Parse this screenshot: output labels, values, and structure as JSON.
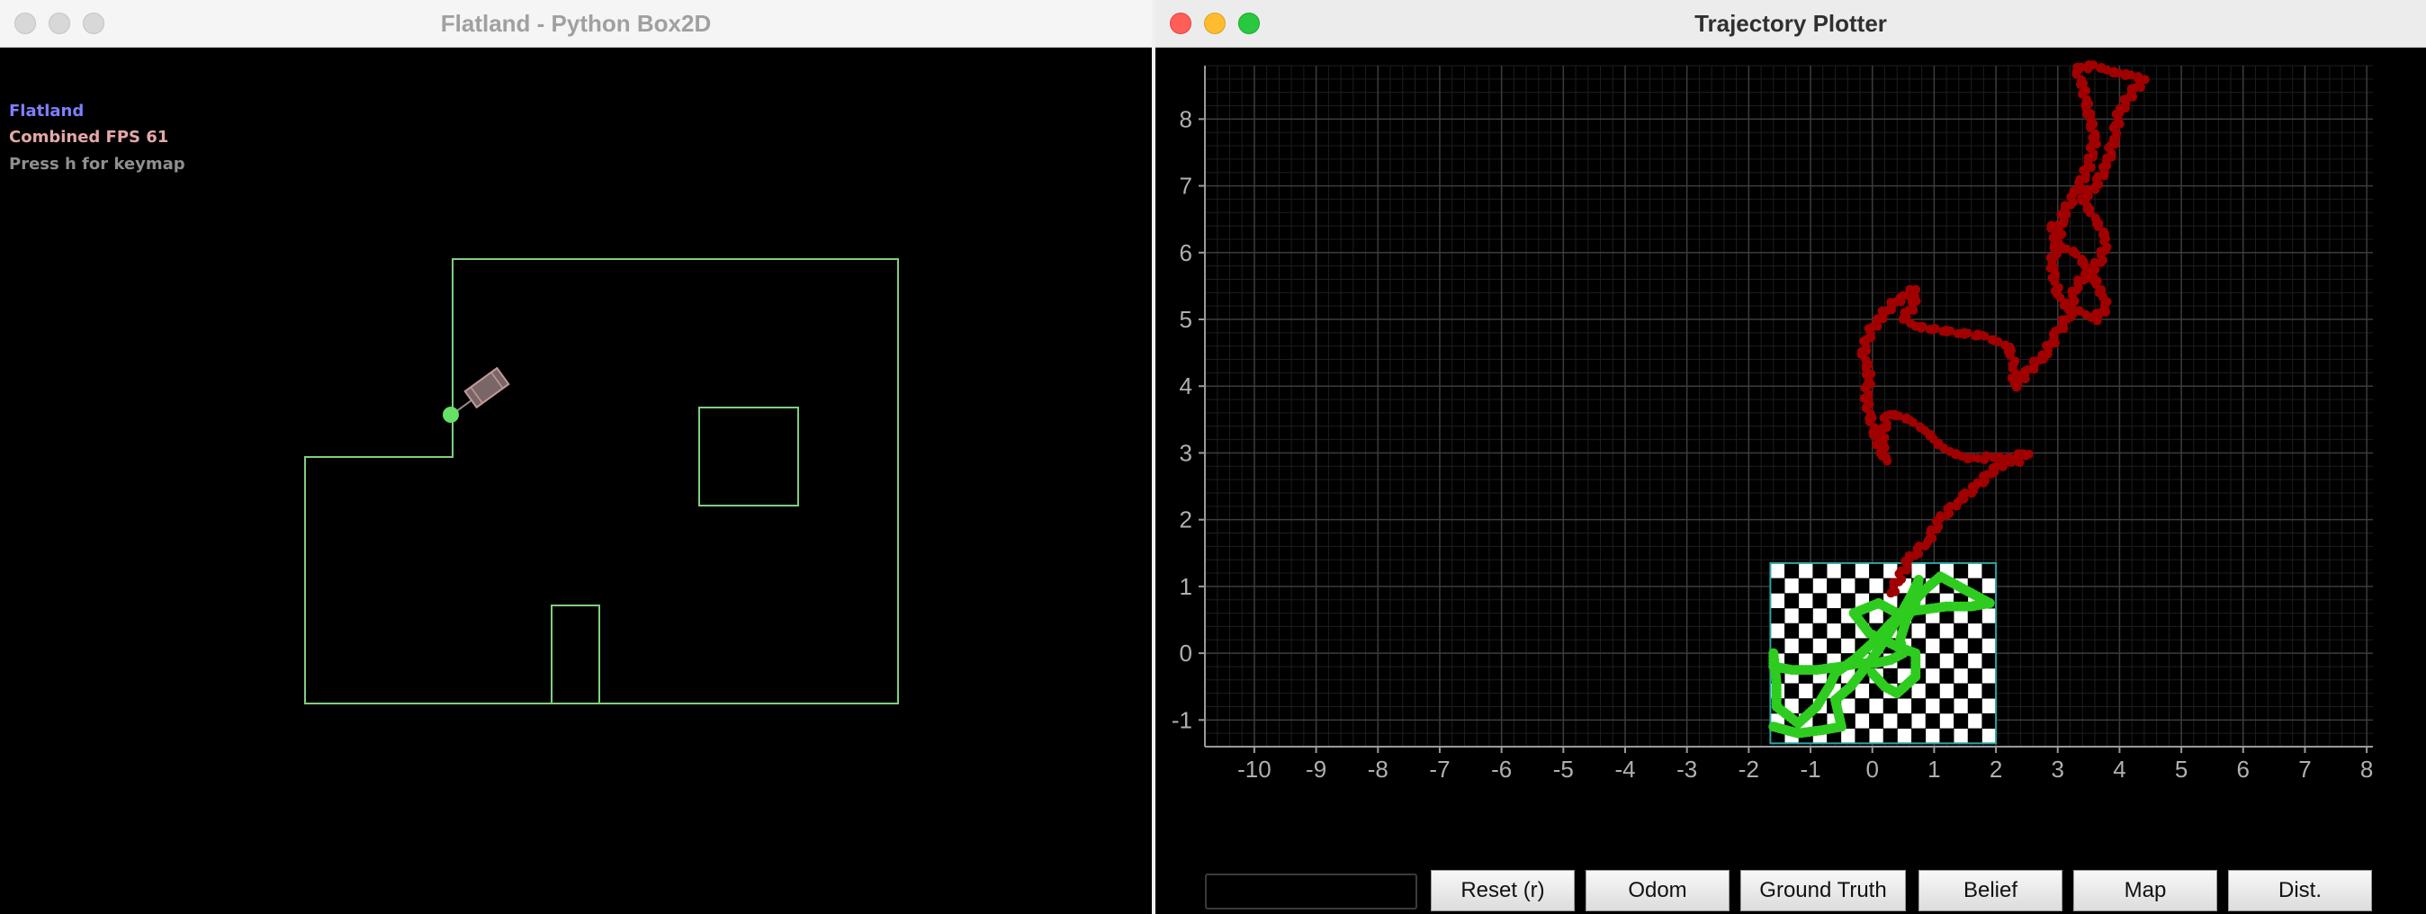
{
  "left_window": {
    "title": "Flatland - Python Box2D",
    "hud": [
      "Flatland",
      "Combined FPS 61",
      "Press h for keymap"
    ],
    "colors": {
      "walls": "#7fcf7f",
      "robot": "#b08a8a",
      "marker": "#66e066",
      "background": "#000000"
    }
  },
  "right_window": {
    "title": "Trajectory Plotter",
    "input_value": "",
    "buttons": [
      "Reset (r)",
      "Odom",
      "Ground Truth",
      "Belief",
      "Map",
      "Dist."
    ]
  },
  "chart_data": {
    "type": "scatter",
    "title": "",
    "xlabel": "",
    "ylabel": "",
    "xlim": [
      -10.8,
      8.1
    ],
    "ylim": [
      -1.4,
      8.8
    ],
    "xticks": [
      -10,
      -9,
      -8,
      -7,
      -6,
      -5,
      -4,
      -3,
      -2,
      -1,
      0,
      1,
      2,
      3,
      4,
      5,
      6,
      7,
      8
    ],
    "yticks": [
      -1,
      0,
      1,
      2,
      3,
      4,
      5,
      6,
      7,
      8
    ],
    "grid": true,
    "legend": "none",
    "overlay": {
      "name": "checkerboard",
      "x_range": [
        -1.65,
        2.0
      ],
      "y_range": [
        -1.35,
        1.35
      ],
      "columns": 16,
      "rows": 12,
      "border_color": "#2aa4a4"
    },
    "series": [
      {
        "color": "#a00000",
        "points": [
          [
            0.3,
            0.9
          ],
          [
            0.6,
            1.4
          ],
          [
            0.9,
            1.7
          ],
          [
            1.1,
            2.0
          ],
          [
            1.4,
            2.3
          ],
          [
            1.7,
            2.5
          ],
          [
            1.9,
            2.7
          ],
          [
            2.2,
            2.9
          ],
          [
            2.5,
            3.0
          ],
          [
            2.3,
            2.85
          ],
          [
            2.0,
            2.95
          ],
          [
            1.6,
            2.9
          ],
          [
            1.3,
            3.0
          ],
          [
            1.1,
            3.1
          ],
          [
            0.9,
            3.3
          ],
          [
            0.6,
            3.5
          ],
          [
            0.25,
            3.6
          ],
          [
            0.15,
            3.2
          ],
          [
            0.2,
            2.9
          ],
          [
            0.1,
            3.1
          ],
          [
            0.0,
            3.4
          ],
          [
            -0.1,
            3.8
          ],
          [
            -0.05,
            4.2
          ],
          [
            -0.15,
            4.5
          ],
          [
            -0.05,
            4.8
          ],
          [
            0.1,
            5.0
          ],
          [
            0.3,
            5.2
          ],
          [
            0.5,
            5.35
          ],
          [
            0.7,
            5.45
          ],
          [
            0.65,
            5.2
          ],
          [
            0.5,
            5.0
          ],
          [
            0.7,
            4.9
          ],
          [
            1.0,
            4.85
          ],
          [
            1.4,
            4.8
          ],
          [
            1.8,
            4.75
          ],
          [
            2.2,
            4.6
          ],
          [
            2.3,
            4.3
          ],
          [
            2.3,
            4.0
          ],
          [
            2.5,
            4.2
          ],
          [
            2.8,
            4.5
          ],
          [
            3.0,
            4.8
          ],
          [
            3.2,
            5.1
          ],
          [
            3.0,
            5.4
          ],
          [
            2.9,
            5.8
          ],
          [
            3.0,
            6.2
          ],
          [
            3.1,
            6.6
          ],
          [
            3.3,
            6.9
          ],
          [
            3.5,
            7.3
          ],
          [
            3.6,
            7.7
          ],
          [
            3.5,
            8.1
          ],
          [
            3.4,
            8.5
          ],
          [
            3.3,
            8.75
          ],
          [
            3.6,
            8.8
          ],
          [
            3.9,
            8.7
          ],
          [
            4.2,
            8.65
          ],
          [
            4.4,
            8.6
          ],
          [
            4.2,
            8.4
          ],
          [
            4.0,
            8.1
          ],
          [
            3.9,
            7.7
          ],
          [
            3.8,
            7.3
          ],
          [
            3.6,
            7.0
          ],
          [
            3.4,
            6.8
          ],
          [
            3.6,
            6.5
          ],
          [
            3.8,
            6.2
          ],
          [
            3.7,
            5.9
          ],
          [
            3.5,
            5.7
          ],
          [
            3.3,
            5.5
          ],
          [
            3.2,
            5.2
          ],
          [
            3.6,
            5.0
          ],
          [
            3.8,
            5.2
          ],
          [
            3.6,
            5.6
          ],
          [
            3.3,
            6.0
          ],
          [
            3.0,
            6.1
          ],
          [
            2.9,
            6.4
          ]
        ]
      },
      {
        "color": "#2ecc1f",
        "points": [
          [
            -1.6,
            -1.1
          ],
          [
            -1.2,
            -1.2
          ],
          [
            -0.8,
            -1.15
          ],
          [
            -0.5,
            -1.1
          ],
          [
            -0.6,
            -0.7
          ],
          [
            -0.35,
            -0.5
          ],
          [
            -0.1,
            -0.2
          ],
          [
            0.1,
            0.05
          ],
          [
            0.3,
            0.35
          ],
          [
            0.5,
            0.65
          ],
          [
            0.65,
            0.9
          ],
          [
            0.75,
            1.1
          ],
          [
            0.7,
            0.75
          ],
          [
            0.55,
            0.5
          ],
          [
            0.45,
            0.2
          ],
          [
            0.5,
            0.0
          ],
          [
            0.3,
            -0.1
          ],
          [
            0.05,
            -0.15
          ],
          [
            -0.2,
            -0.15
          ],
          [
            -0.5,
            -0.2
          ],
          [
            -0.9,
            -0.25
          ],
          [
            -1.3,
            -0.25
          ],
          [
            -1.6,
            -0.2
          ],
          [
            -1.6,
            0.0
          ],
          [
            -1.55,
            -0.45
          ],
          [
            -1.55,
            -0.8
          ],
          [
            -1.2,
            -1.05
          ],
          [
            -0.9,
            -0.8
          ],
          [
            -0.7,
            -0.5
          ],
          [
            -0.6,
            -0.3
          ],
          [
            -0.3,
            -0.1
          ],
          [
            0.0,
            0.15
          ],
          [
            0.3,
            0.45
          ],
          [
            0.6,
            0.7
          ],
          [
            0.85,
            0.95
          ],
          [
            1.1,
            1.15
          ],
          [
            1.5,
            0.95
          ],
          [
            1.9,
            0.75
          ],
          [
            1.6,
            0.7
          ],
          [
            1.2,
            0.7
          ],
          [
            0.8,
            0.65
          ],
          [
            0.4,
            0.6
          ],
          [
            0.1,
            0.75
          ],
          [
            -0.3,
            0.6
          ],
          [
            -0.05,
            0.3
          ],
          [
            0.4,
            0.1
          ],
          [
            0.7,
            0.0
          ],
          [
            0.7,
            -0.35
          ],
          [
            0.4,
            -0.6
          ],
          [
            0.2,
            -0.5
          ],
          [
            0.0,
            -0.3
          ]
        ]
      }
    ]
  }
}
